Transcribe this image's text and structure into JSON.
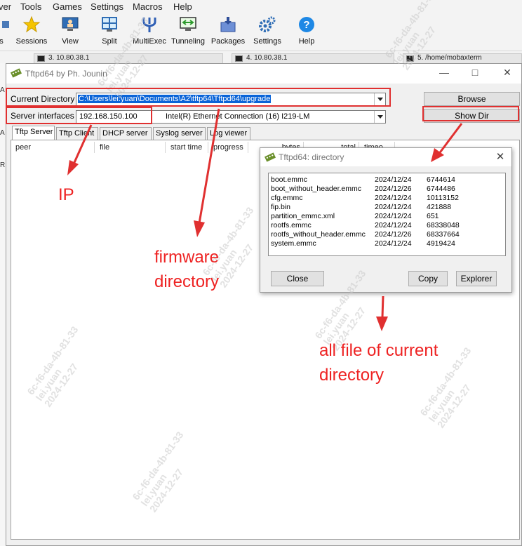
{
  "mobaxterm": {
    "menu": [
      "ver",
      "Tools",
      "Games",
      "Settings",
      "Macros",
      "Help"
    ],
    "toolbar": [
      {
        "label": "s",
        "icon": "sessions-edge-icon"
      },
      {
        "label": "Sessions",
        "icon": "star-icon"
      },
      {
        "label": "View",
        "icon": "monitor-user-icon"
      },
      {
        "label": "Split",
        "icon": "split-window-icon"
      },
      {
        "label": "MultiExec",
        "icon": "fork-icon"
      },
      {
        "label": "Tunneling",
        "icon": "tunnel-monitor-icon"
      },
      {
        "label": "Packages",
        "icon": "package-icon"
      },
      {
        "label": "Settings",
        "icon": "gears-icon"
      },
      {
        "label": "Help",
        "icon": "help-icon"
      }
    ],
    "terminal_tabs": [
      "3. 10.80.38.1",
      "4. 10.80.38.1",
      "5. /home/mobaxterm"
    ],
    "left_letters": [
      "A",
      "A",
      "R"
    ]
  },
  "tftpd": {
    "title": "Tftpd64 by Ph. Jounin",
    "current_directory_label": "Current Directory",
    "current_directory_value": "C:\\Users\\lei.yuan\\Documents\\A2\\tftp64\\Tftpd64\\upgrade",
    "server_interfaces_label": "Server interfaces",
    "server_ip": "192.168.150.100",
    "interface_name": "Intel(R) Ethernet Connection (16) I219-LM",
    "browse_label": "Browse",
    "show_dir_label": "Show Dir",
    "tabs": [
      "Tftp Server",
      "Tftp Client",
      "DHCP server",
      "Syslog server",
      "Log viewer"
    ],
    "columns": [
      "peer",
      "file",
      "start time",
      "progress",
      "bytes",
      "total",
      "timeo"
    ]
  },
  "directory_dialog": {
    "title": "Tftpd64: directory",
    "files": [
      {
        "name": "boot.emmc",
        "date": "2024/12/24",
        "size": "6744614"
      },
      {
        "name": "boot_without_header.emmc",
        "date": "2024/12/26",
        "size": "6744486"
      },
      {
        "name": "cfg.emmc",
        "date": "2024/12/24",
        "size": "10113152"
      },
      {
        "name": "fip.bin",
        "date": "2024/12/24",
        "size": "421888"
      },
      {
        "name": "partition_emmc.xml",
        "date": "2024/12/24",
        "size": "651"
      },
      {
        "name": "rootfs.emmc",
        "date": "2024/12/24",
        "size": "68338048"
      },
      {
        "name": "rootfs_without_header.emmc",
        "date": "2024/12/26",
        "size": "68337664"
      },
      {
        "name": "system.emmc",
        "date": "2024/12/24",
        "size": "4919424"
      }
    ],
    "close_label": "Close",
    "copy_label": "Copy",
    "explorer_label": "Explorer"
  },
  "annotations": {
    "ip": "IP",
    "firmware_line1": "firmware",
    "firmware_line2": "directory",
    "files_line1": "all file of current",
    "files_line2": "directory",
    "color": "#e03030"
  },
  "watermark": {
    "line1": "6c-f6-da-4b-81-33",
    "line2": "lei.yuan",
    "line3": "2024-12-27"
  }
}
